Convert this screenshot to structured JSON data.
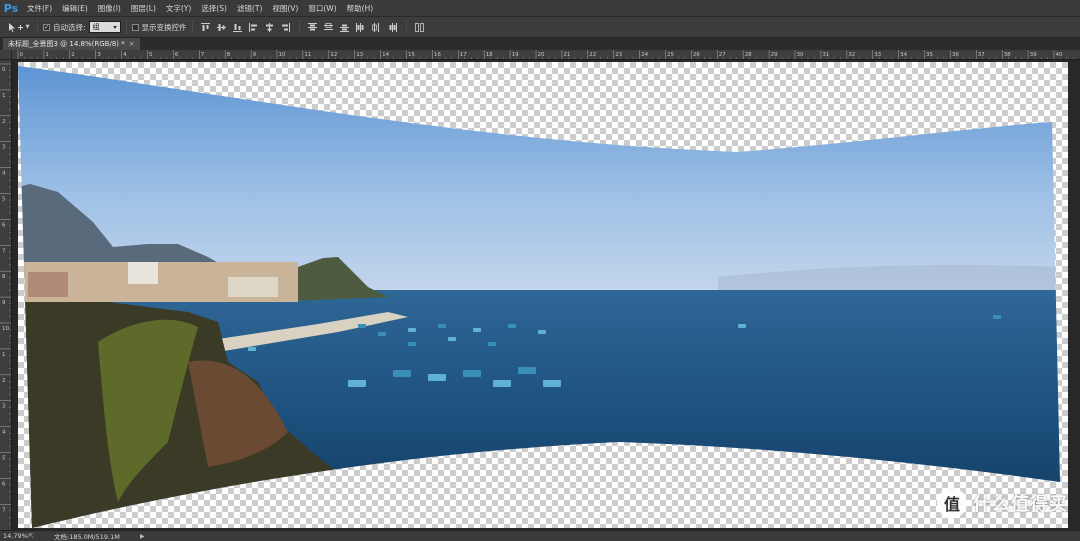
{
  "app": {
    "logo": "Ps"
  },
  "menu": [
    "文件(F)",
    "编辑(E)",
    "图像(I)",
    "图层(L)",
    "文字(Y)",
    "选择(S)",
    "滤镜(T)",
    "视图(V)",
    "窗口(W)",
    "帮助(H)"
  ],
  "options": {
    "tool_icon": "move-tool-icon",
    "auto_select_label": "自动选择:",
    "auto_select_checked": true,
    "auto_select_value": "组",
    "show_transform_label": "显示变换控件",
    "show_transform_checked": false
  },
  "document": {
    "tab_title": "未标题_全景图3 @ 14.8%(RGB/8) *",
    "close": "×"
  },
  "rulers": {
    "h": [
      "0",
      "1",
      "2",
      "3",
      "4",
      "5",
      "6",
      "7",
      "8",
      "9",
      "10",
      "11",
      "12",
      "13",
      "14",
      "15",
      "16",
      "17",
      "18",
      "19",
      "20",
      "21",
      "22",
      "23",
      "24",
      "25",
      "26",
      "27",
      "28",
      "29",
      "30",
      "31",
      "32",
      "33",
      "34",
      "35",
      "36",
      "37",
      "38",
      "39",
      "40"
    ],
    "v": [
      "0",
      "1",
      "2",
      "3",
      "4",
      "5",
      "6",
      "7",
      "8",
      "9",
      "10",
      "1",
      "2",
      "3",
      "4",
      "5",
      "6",
      "7"
    ]
  },
  "status": {
    "zoom": "14.79%",
    "doc_info": "文档:185.0M/519.1M",
    "arrow": "▶"
  },
  "watermark": {
    "logo": "值",
    "text": "什么值得买"
  },
  "colors": {
    "accent": "#3b9ae0",
    "sky_top": "#5d95d4",
    "sea": "#1c4d78"
  }
}
